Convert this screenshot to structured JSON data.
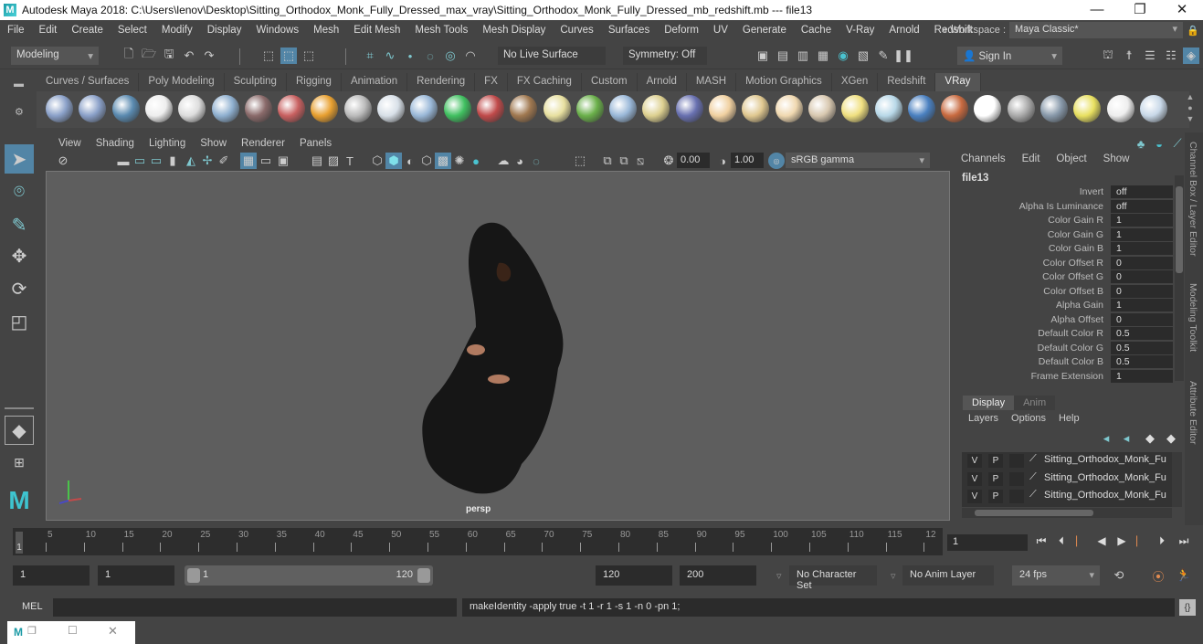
{
  "window": {
    "title": "Autodesk Maya 2018: C:\\Users\\lenov\\Desktop\\Sitting_Orthodox_Monk_Fully_Dressed_max_vray\\Sitting_Orthodox_Monk_Fully_Dressed_mb_redshift.mb  ---  file13",
    "logo": "M",
    "minimize": "—",
    "restore": "❐",
    "close": "✕"
  },
  "menubar": {
    "items": [
      "File",
      "Edit",
      "Create",
      "Select",
      "Modify",
      "Display",
      "Windows",
      "Mesh",
      "Edit Mesh",
      "Mesh Tools",
      "Mesh Display",
      "Curves",
      "Surfaces",
      "Deform",
      "UV",
      "Generate",
      "Cache",
      "V-Ray",
      "Arnold",
      "Redshift"
    ],
    "workspace_label": "»  Workspace :",
    "workspace_value": "Maya Classic*"
  },
  "statusline": {
    "mode": "Modeling",
    "live_surface": "No Live Surface",
    "symmetry": "Symmetry: Off",
    "sign_in": "Sign In"
  },
  "shelf": {
    "tabs": [
      "Curves / Surfaces",
      "Poly Modeling",
      "Sculpting",
      "Rigging",
      "Animation",
      "Rendering",
      "FX",
      "FX Caching",
      "Custom",
      "Arnold",
      "MASH",
      "Motion Graphics",
      "XGen",
      "Redshift",
      "VRay"
    ],
    "active_tab": "VRay",
    "icons": [
      "vray-save-icon",
      "vray-load-icon",
      "vray-settings-icon",
      "vray-logo-icon",
      "vray-framebuffer-icon",
      "vray-material-icon",
      "vray-camera-icon",
      "vray-multi-material-icon",
      "vray-fire-icon",
      "vray-proxy-icon",
      "vray-sphere-light-icon",
      "vray-shapes-icon",
      "vray-plane-light-icon",
      "vray-displacement-icon",
      "vray-texture-icon",
      "vray-dome-icon",
      "vray-fur-icon",
      "vray-clipper-icon",
      "vray-curve-icon",
      "vray-sphere-icon",
      "vray-dome-light-icon",
      "vray-spot-icon",
      "vray-omni-icon",
      "vray-ies-icon",
      "vray-sun-icon",
      "vray-rect-light-icon",
      "vray-blue-sphere-icon",
      "vray-striped-sphere-icon",
      "vray-checker-icon",
      "vray-vfb-icon",
      "vray-render-elements-icon",
      "vray-light-lister-icon",
      "vray-cloud-icon",
      "vray-help-icon"
    ]
  },
  "panel": {
    "menus": [
      "View",
      "Shading",
      "Lighting",
      "Show",
      "Renderer",
      "Panels"
    ],
    "exposure": "0.00",
    "gamma": "1.00",
    "color_space": "sRGB gamma",
    "camera_label": "persp"
  },
  "channel_box": {
    "menus": [
      "Channels",
      "Edit",
      "Object",
      "Show"
    ],
    "object": "file13",
    "attributes": [
      {
        "name": "Invert",
        "value": "off"
      },
      {
        "name": "Alpha Is Luminance",
        "value": "off"
      },
      {
        "name": "Color Gain R",
        "value": "1"
      },
      {
        "name": "Color Gain G",
        "value": "1"
      },
      {
        "name": "Color Gain B",
        "value": "1"
      },
      {
        "name": "Color Offset R",
        "value": "0"
      },
      {
        "name": "Color Offset G",
        "value": "0"
      },
      {
        "name": "Color Offset B",
        "value": "0"
      },
      {
        "name": "Alpha Gain",
        "value": "1"
      },
      {
        "name": "Alpha Offset",
        "value": "0"
      },
      {
        "name": "Default Color R",
        "value": "0.5"
      },
      {
        "name": "Default Color G",
        "value": "0.5"
      },
      {
        "name": "Default Color B",
        "value": "0.5"
      },
      {
        "name": "Frame Extension",
        "value": "1"
      }
    ]
  },
  "side_tabs": [
    "Channel Box / Layer Editor",
    "Modeling Toolkit",
    "Attribute Editor"
  ],
  "layer_editor": {
    "tabs": [
      "Display",
      "Anim"
    ],
    "active_tab": "Display",
    "menus": [
      "Layers",
      "Options",
      "Help"
    ],
    "layers": [
      {
        "v": "V",
        "p": "P",
        "name": "Sitting_Orthodox_Monk_Fu"
      },
      {
        "v": "V",
        "p": "P",
        "name": "Sitting_Orthodox_Monk_Fu"
      },
      {
        "v": "V",
        "p": "P",
        "name": "Sitting_Orthodox_Monk_Fu"
      }
    ]
  },
  "timeline": {
    "ticks": [
      "5",
      "10",
      "15",
      "20",
      "25",
      "30",
      "35",
      "40",
      "45",
      "50",
      "55",
      "60",
      "65",
      "70",
      "75",
      "80",
      "85",
      "90",
      "95",
      "100",
      "105",
      "110",
      "115",
      "12"
    ],
    "current_marker": "1",
    "current_frame": "1"
  },
  "range": {
    "start": "1",
    "playback_start": "1",
    "slider_min": "1",
    "slider_max": "120",
    "playback_end": "120",
    "end": "200",
    "character_set": "No Character Set",
    "anim_layer": "No Anim Layer",
    "fps": "24 fps"
  },
  "command_line": {
    "label": "MEL",
    "input": "",
    "output": "makeIdentity -apply true -t 1 -r 1 -s 1 -n 0 -pn 1;"
  },
  "taskbar": {
    "logo": "M"
  }
}
